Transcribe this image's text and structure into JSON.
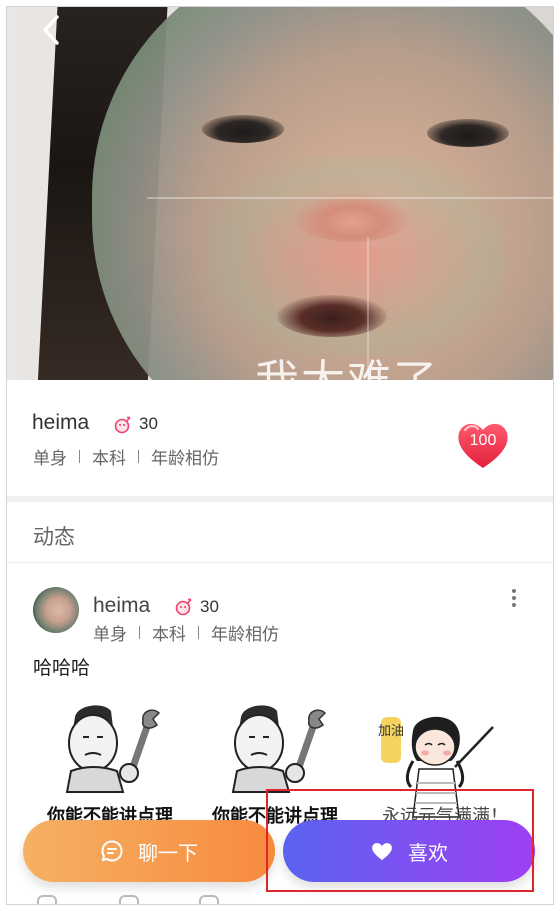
{
  "hero": {
    "overlay_text": "我太难了",
    "back_icon": "chevron-left-icon"
  },
  "profile": {
    "name": "heima",
    "age": "30",
    "gender_icon": "female-icon",
    "tags": [
      "单身",
      "本科",
      "年龄相仿"
    ],
    "score": "100",
    "score_color": "#e8314b"
  },
  "feed": {
    "title": "动态",
    "post": {
      "name": "heima",
      "age": "30",
      "tags": [
        "单身",
        "本科",
        "年龄相仿"
      ],
      "text": "哈哈哈",
      "images": [
        {
          "caption": "你能不能讲点理"
        },
        {
          "caption": "你能不能讲点理"
        },
        {
          "caption": "加油",
          "caption2": "永远元气满满！"
        }
      ]
    }
  },
  "actions": {
    "chat_label": "聊一下",
    "like_label": "喜欢",
    "chat_color": "#f88a3e",
    "like_color": "#7b4ff2"
  },
  "highlight_color": "#e0262b"
}
